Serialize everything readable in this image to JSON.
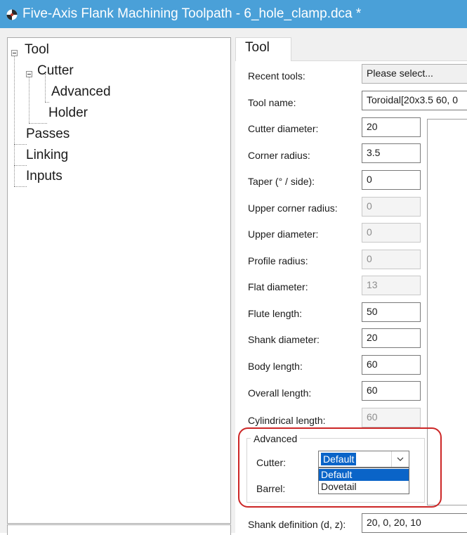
{
  "window": {
    "title": "Five-Axis Flank Machining Toolpath - 6_hole_clamp.dca *",
    "accent": "#4aa0d8"
  },
  "tree": {
    "items": [
      {
        "label": "Tool"
      },
      {
        "label": "Cutter"
      },
      {
        "label": "Advanced"
      },
      {
        "label": "Holder"
      },
      {
        "label": "Passes"
      },
      {
        "label": "Linking"
      },
      {
        "label": "Inputs"
      }
    ]
  },
  "tab": {
    "label": "Tool"
  },
  "form": {
    "recent_tools": {
      "label": "Recent tools:",
      "value": "Please select..."
    },
    "tool_name": {
      "label": "Tool name:",
      "value": "Toroidal[20x3.5 60, 0"
    },
    "cutter_diameter": {
      "label": "Cutter diameter:",
      "value": "20"
    },
    "corner_radius": {
      "label": "Corner radius:",
      "value": "3.5"
    },
    "taper": {
      "label": "Taper (° / side):",
      "value": "0"
    },
    "upper_corner_radius": {
      "label": "Upper corner radius:",
      "value": "0"
    },
    "upper_diameter": {
      "label": "Upper diameter:",
      "value": "0"
    },
    "profile_radius": {
      "label": "Profile radius:",
      "value": "0"
    },
    "flat_diameter": {
      "label": "Flat diameter:",
      "value": "13"
    },
    "flute_length": {
      "label": "Flute length:",
      "value": "50"
    },
    "shank_diameter": {
      "label": "Shank diameter:",
      "value": "20"
    },
    "body_length": {
      "label": "Body length:",
      "value": "60"
    },
    "overall_length": {
      "label": "Overall length:",
      "value": "60"
    },
    "cylindrical_length": {
      "label": "Cylindrical length:",
      "value": "60"
    },
    "shank_definition": {
      "label": "Shank definition (d, z):",
      "value": "20, 0, 20, 10"
    }
  },
  "advanced": {
    "title": "Advanced",
    "cutter_label": "Cutter:",
    "cutter_value": "Default",
    "barrel_label": "Barrel:",
    "options": [
      "Default",
      "Dovetail"
    ],
    "highlight_color": "#cc2626"
  }
}
